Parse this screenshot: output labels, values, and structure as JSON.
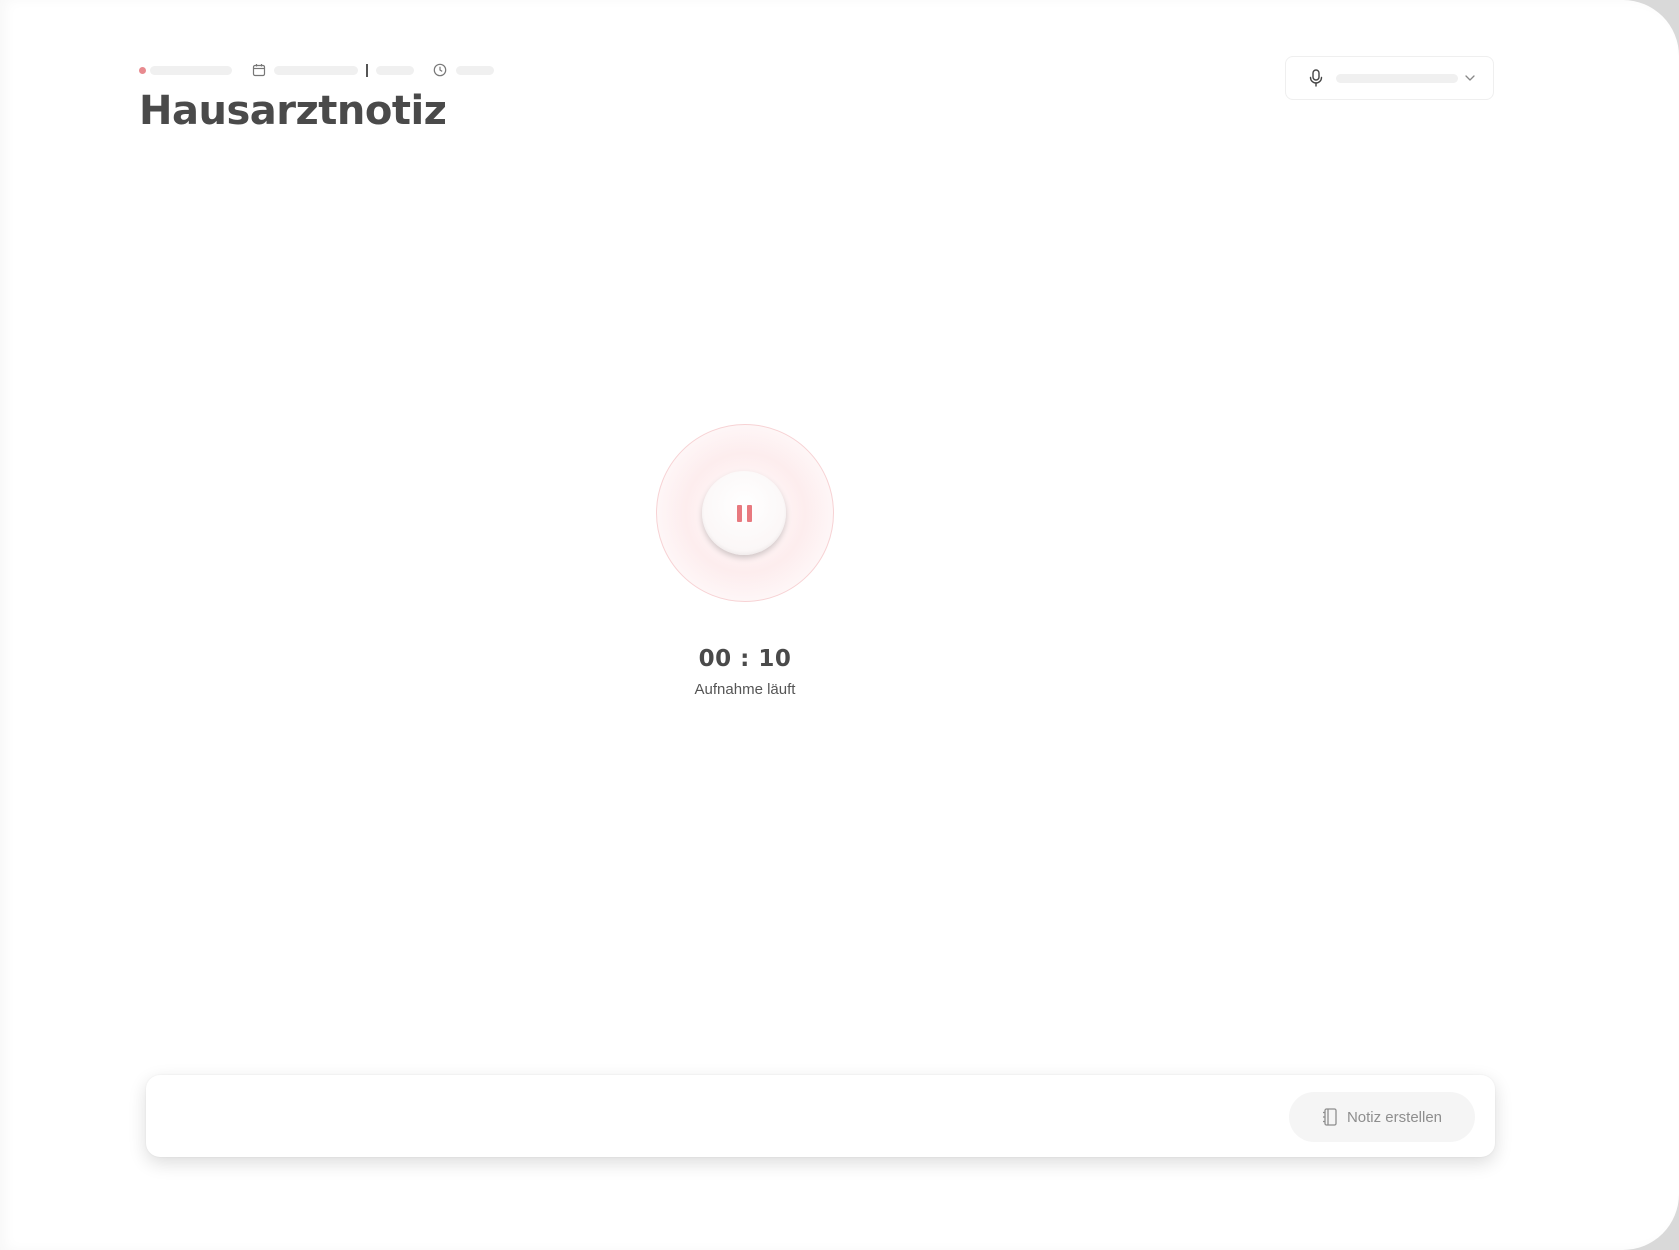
{
  "header": {
    "title": "Hausarztnotiz",
    "meta": {
      "status_icon": "status-dot",
      "date_icon": "calendar-icon",
      "time_icon": "clock-icon",
      "separator": "|"
    }
  },
  "microphone": {
    "icon": "microphone-icon",
    "dropdown_icon": "chevron-down-icon"
  },
  "recorder": {
    "timer": "00 : 10",
    "status": "Aufnahme läuft",
    "button_icon": "pause-icon",
    "accent_color": "#e8797f"
  },
  "footer": {
    "create_note_label": "Notiz erstellen",
    "create_note_icon": "notebook-icon"
  },
  "colors": {
    "title": "#4a4a4a",
    "status_dot": "#e88a8f",
    "ring": "#f7d2d4",
    "button_bg": "#f5f5f5"
  }
}
